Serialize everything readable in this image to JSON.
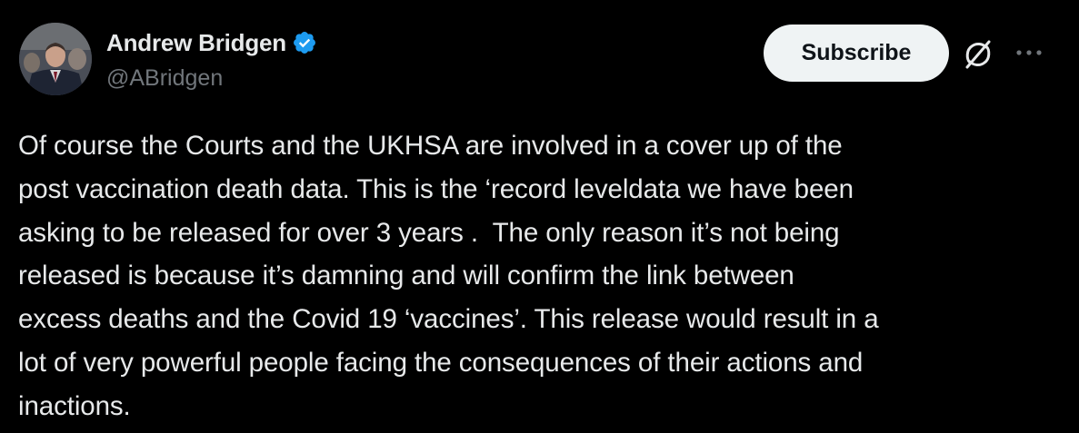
{
  "author": {
    "display_name": "Andrew Bridgen",
    "handle": "@ABridgen",
    "verified": true
  },
  "actions": {
    "subscribe_label": "Subscribe",
    "grok_icon": "grok-icon",
    "more_icon": "more-icon"
  },
  "tweet": {
    "text": "Of course the Courts and the UKHSA are involved in a cover up of the\npost vaccination death data. This is the ‘record leveldata we have been\nasking to be released for over 3 years .  The only reason it’s not being\nreleased is because it’s damning and will confirm the link between\nexcess deaths and the Covid 19 ‘vaccines’. This release would result in a\nlot of very powerful people facing the consequences of their actions and\ninactions."
  },
  "colors": {
    "background": "#000000",
    "primary_text": "#e7e9ea",
    "secondary_text": "#71767b",
    "verified_blue": "#1d9bf0",
    "button_bg": "#eff3f4",
    "button_text": "#0f1419"
  }
}
